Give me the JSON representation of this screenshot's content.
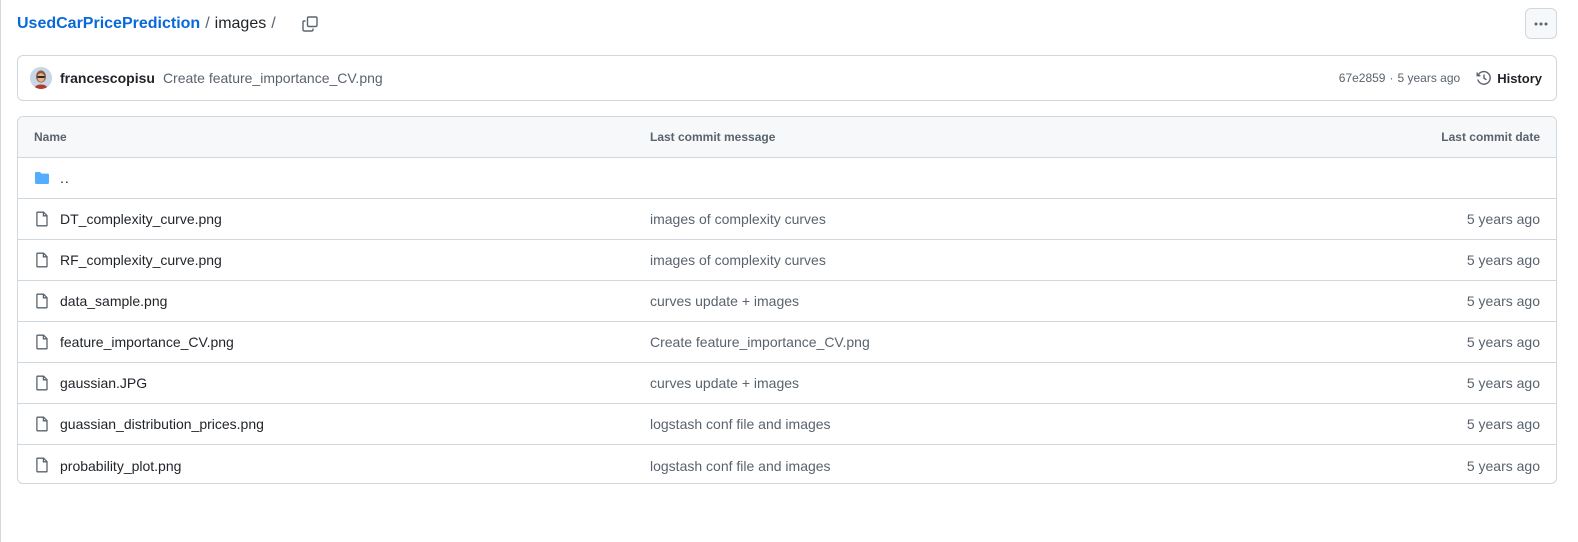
{
  "breadcrumb": {
    "repo": "UsedCarPricePrediction",
    "sep1": "/",
    "dir": "images",
    "sep2": "/"
  },
  "icons": {
    "copy": "copy-icon",
    "more": "kebab-horizontal-icon",
    "history": "history-icon",
    "folder": "folder-icon",
    "file": "file-icon"
  },
  "colors": {
    "link": "#0969da",
    "folder": "#54aeff",
    "muted": "#59636e",
    "border": "#d0d7de"
  },
  "latest_commit": {
    "author": "francescopisu",
    "message": "Create feature_importance_CV.png",
    "sha": "67e2859",
    "separator": "·",
    "time": "5 years ago",
    "history_label": "History"
  },
  "table": {
    "headers": {
      "name": "Name",
      "message": "Last commit message",
      "date": "Last commit date"
    },
    "parent_link": "..",
    "files": [
      {
        "name": "DT_complexity_curve.png",
        "message": "images of complexity curves",
        "date": "5 years ago"
      },
      {
        "name": "RF_complexity_curve.png",
        "message": "images of complexity curves",
        "date": "5 years ago"
      },
      {
        "name": "data_sample.png",
        "message": "curves update + images",
        "date": "5 years ago"
      },
      {
        "name": "feature_importance_CV.png",
        "message": "Create feature_importance_CV.png",
        "date": "5 years ago"
      },
      {
        "name": "gaussian.JPG",
        "message": "curves update + images",
        "date": "5 years ago"
      },
      {
        "name": "guassian_distribution_prices.png",
        "message": "logstash conf file and images",
        "date": "5 years ago"
      },
      {
        "name": "probability_plot.png",
        "message": "logstash conf file and images",
        "date": "5 years ago"
      }
    ]
  }
}
